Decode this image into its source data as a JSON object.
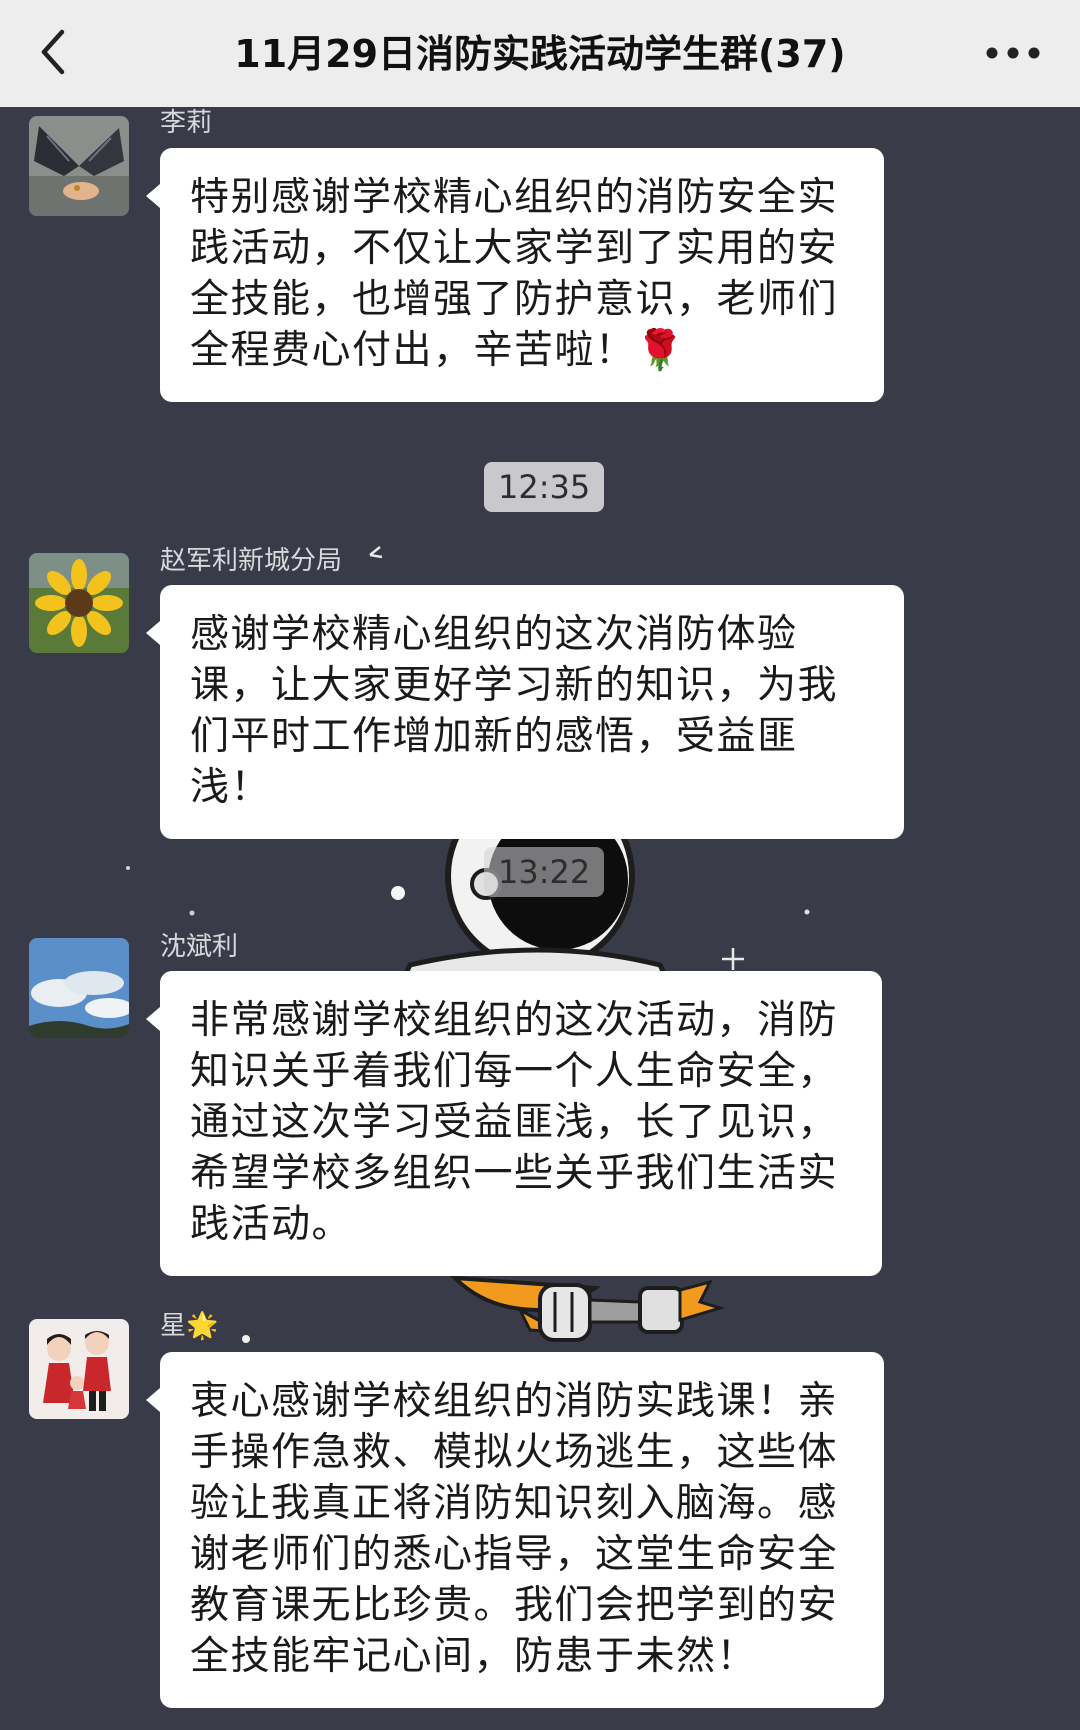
{
  "header": {
    "title": "11月29日消防实践活动学生群(37)"
  },
  "messages": [
    {
      "sender": "李莉",
      "avatar": "butterfly-avatar",
      "text": "特别感谢学校精心组织的消防安全实践活动，不仅让大家学到了实用的安全技能，也增强了防护意识，老师们全程费心付出，辛苦啦！",
      "emoji": "🌹"
    },
    {
      "sender": "赵军利新城分局",
      "avatar": "sunflower-avatar",
      "text": "感谢学校精心组织的这次消防体验课，让大家更好学习新的知识，为我们平时工作增加新的感悟，受益匪浅！"
    },
    {
      "sender": "沈斌利",
      "avatar": "sky-avatar",
      "text": "非常感谢学校组织的这次活动，消防知识关乎着我们每一个人生命安全，通过这次学习受益匪浅，长了见识，希望学校多组织一些关乎我们生活实践活动。"
    },
    {
      "sender": "星",
      "sender_emoji": "🌟",
      "avatar": "couple-avatar",
      "text": "衷心感谢学校组织的消防实践课！亲手操作急救、模拟火场逃生，这些体验让我真正将消防知识刻入脑海。感谢老师们的悉心指导，这堂生命安全教育课无比珍贵。我们会把学到的安全技能牢记心间，防患于未然！"
    }
  ],
  "timestamps": [
    "12:35",
    "13:22"
  ],
  "colors": {
    "background": "#393b49",
    "header": "#ededed",
    "bubble": "#ffffff",
    "time_badge": "#c9c9cd"
  }
}
